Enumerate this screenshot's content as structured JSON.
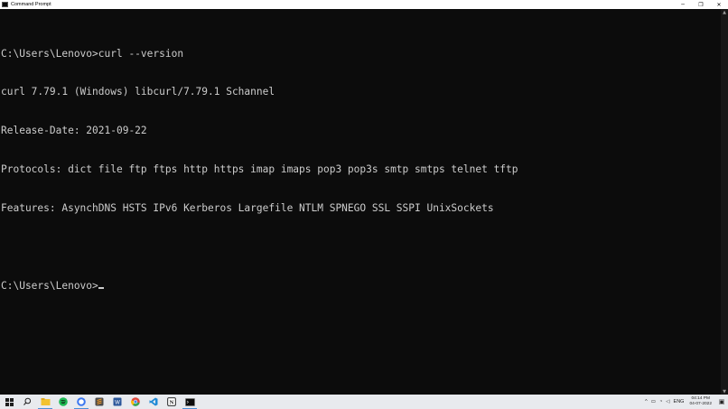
{
  "window": {
    "title": "Command Prompt",
    "controls": {
      "minimize": "─",
      "maximize": "❐",
      "close": "✕"
    }
  },
  "console": {
    "lines": [
      "C:\\Users\\Lenovo>curl --version",
      "curl 7.79.1 (Windows) libcurl/7.79.1 Schannel",
      "Release-Date: 2021-09-22",
      "Protocols: dict file ftp ftps http https imap imaps pop3 pop3s smtp smtps telnet tftp",
      "Features: AsynchDNS HSTS IPv6 Kerberos Largefile NTLM SPNEGO SSL SSPI UnixSockets",
      "",
      "C:\\Users\\Lenovo>"
    ]
  },
  "scrollbar": {
    "up": "▲",
    "down": "▼"
  },
  "taskbar": {
    "apps": [
      {
        "name": "start-icon",
        "color": "#1f1f1f"
      },
      {
        "name": "search-icon",
        "color": "#222222"
      },
      {
        "name": "file-explorer-icon",
        "color": "#f2c230"
      },
      {
        "name": "spotify-icon",
        "color": "#1db954"
      },
      {
        "name": "signal-icon",
        "color": "#3a76f0"
      },
      {
        "name": "sublime-icon",
        "color": "#4b4b4b"
      },
      {
        "name": "word-icon",
        "color": "#2b579a"
      },
      {
        "name": "chrome-icon",
        "color": "#e0463a"
      },
      {
        "name": "vscode-icon",
        "color": "#1f8ad6"
      },
      {
        "name": "notion-icon",
        "color": "#111111"
      },
      {
        "name": "cmd-icon",
        "color": "#0c0c0c"
      }
    ],
    "tray": {
      "chevron": "^",
      "battery": "▭",
      "wifi": "◔",
      "volume": "◁",
      "language": "ENG",
      "time": "04:14 PM",
      "date": "04-07-2022",
      "notifications": "▣"
    }
  }
}
